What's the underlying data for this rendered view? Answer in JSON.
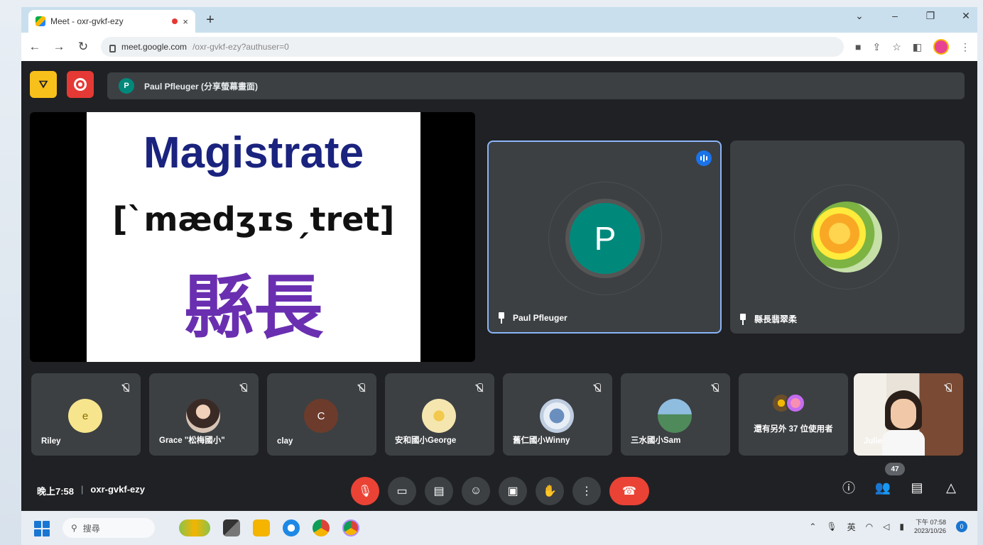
{
  "browser": {
    "tab_title": "Meet - oxr-gvkf-ezy",
    "tab_close": "×",
    "new_tab": "+",
    "url_host": "meet.google.com",
    "url_path": "/oxr-gvkf-ezy?authuser=0",
    "window_controls": [
      "⌄",
      "–",
      "❐",
      "✕"
    ]
  },
  "presenter_bar": {
    "avatar_letter": "P",
    "label": "Paul Pfleuger (分享螢幕畫面)"
  },
  "slide": {
    "word": "Magistrate",
    "ipa": "[ˋmædʒɪsˏtret]",
    "chinese": "縣長"
  },
  "main_tiles": [
    {
      "name": "Paul Pfleuger",
      "avatar_letter": "P"
    },
    {
      "name": "縣長翡翠柔"
    }
  ],
  "participants": [
    {
      "name": "Riley",
      "avatar_letter": "e",
      "color": "#f6e58d"
    },
    {
      "name": "Grace \"松梅國小\"",
      "avatar_letter": "",
      "color": "#d7c4b4"
    },
    {
      "name": "clay",
      "avatar_letter": "C",
      "color": "#6d3b2b"
    },
    {
      "name": "安和國小George",
      "avatar_letter": "",
      "color": "#f5e6b0"
    },
    {
      "name": "舊仁國小Winny",
      "avatar_letter": "",
      "color": "#bfcde0"
    },
    {
      "name": "三水國小Sam",
      "avatar_letter": "",
      "color": "#7aa7c7"
    }
  ],
  "others_tile": {
    "label": "還有另外 37 位使用者"
  },
  "self_tile": {
    "name": "Julie"
  },
  "meeting_info": {
    "time": "晚上7:58",
    "separator": "|",
    "code": "oxr-gvkf-ezy"
  },
  "people_count": "47",
  "taskbar": {
    "search_placeholder": "搜尋",
    "input_method": "英",
    "clock_time": "下午 07:58",
    "clock_date": "2023/10/26",
    "notification_count": "0"
  },
  "colors": {
    "meet_bg": "#202124",
    "tile_bg": "#3c4043",
    "end_call": "#ea4335",
    "active_border": "#8ab4f8",
    "teal_avatar": "#00897b"
  }
}
